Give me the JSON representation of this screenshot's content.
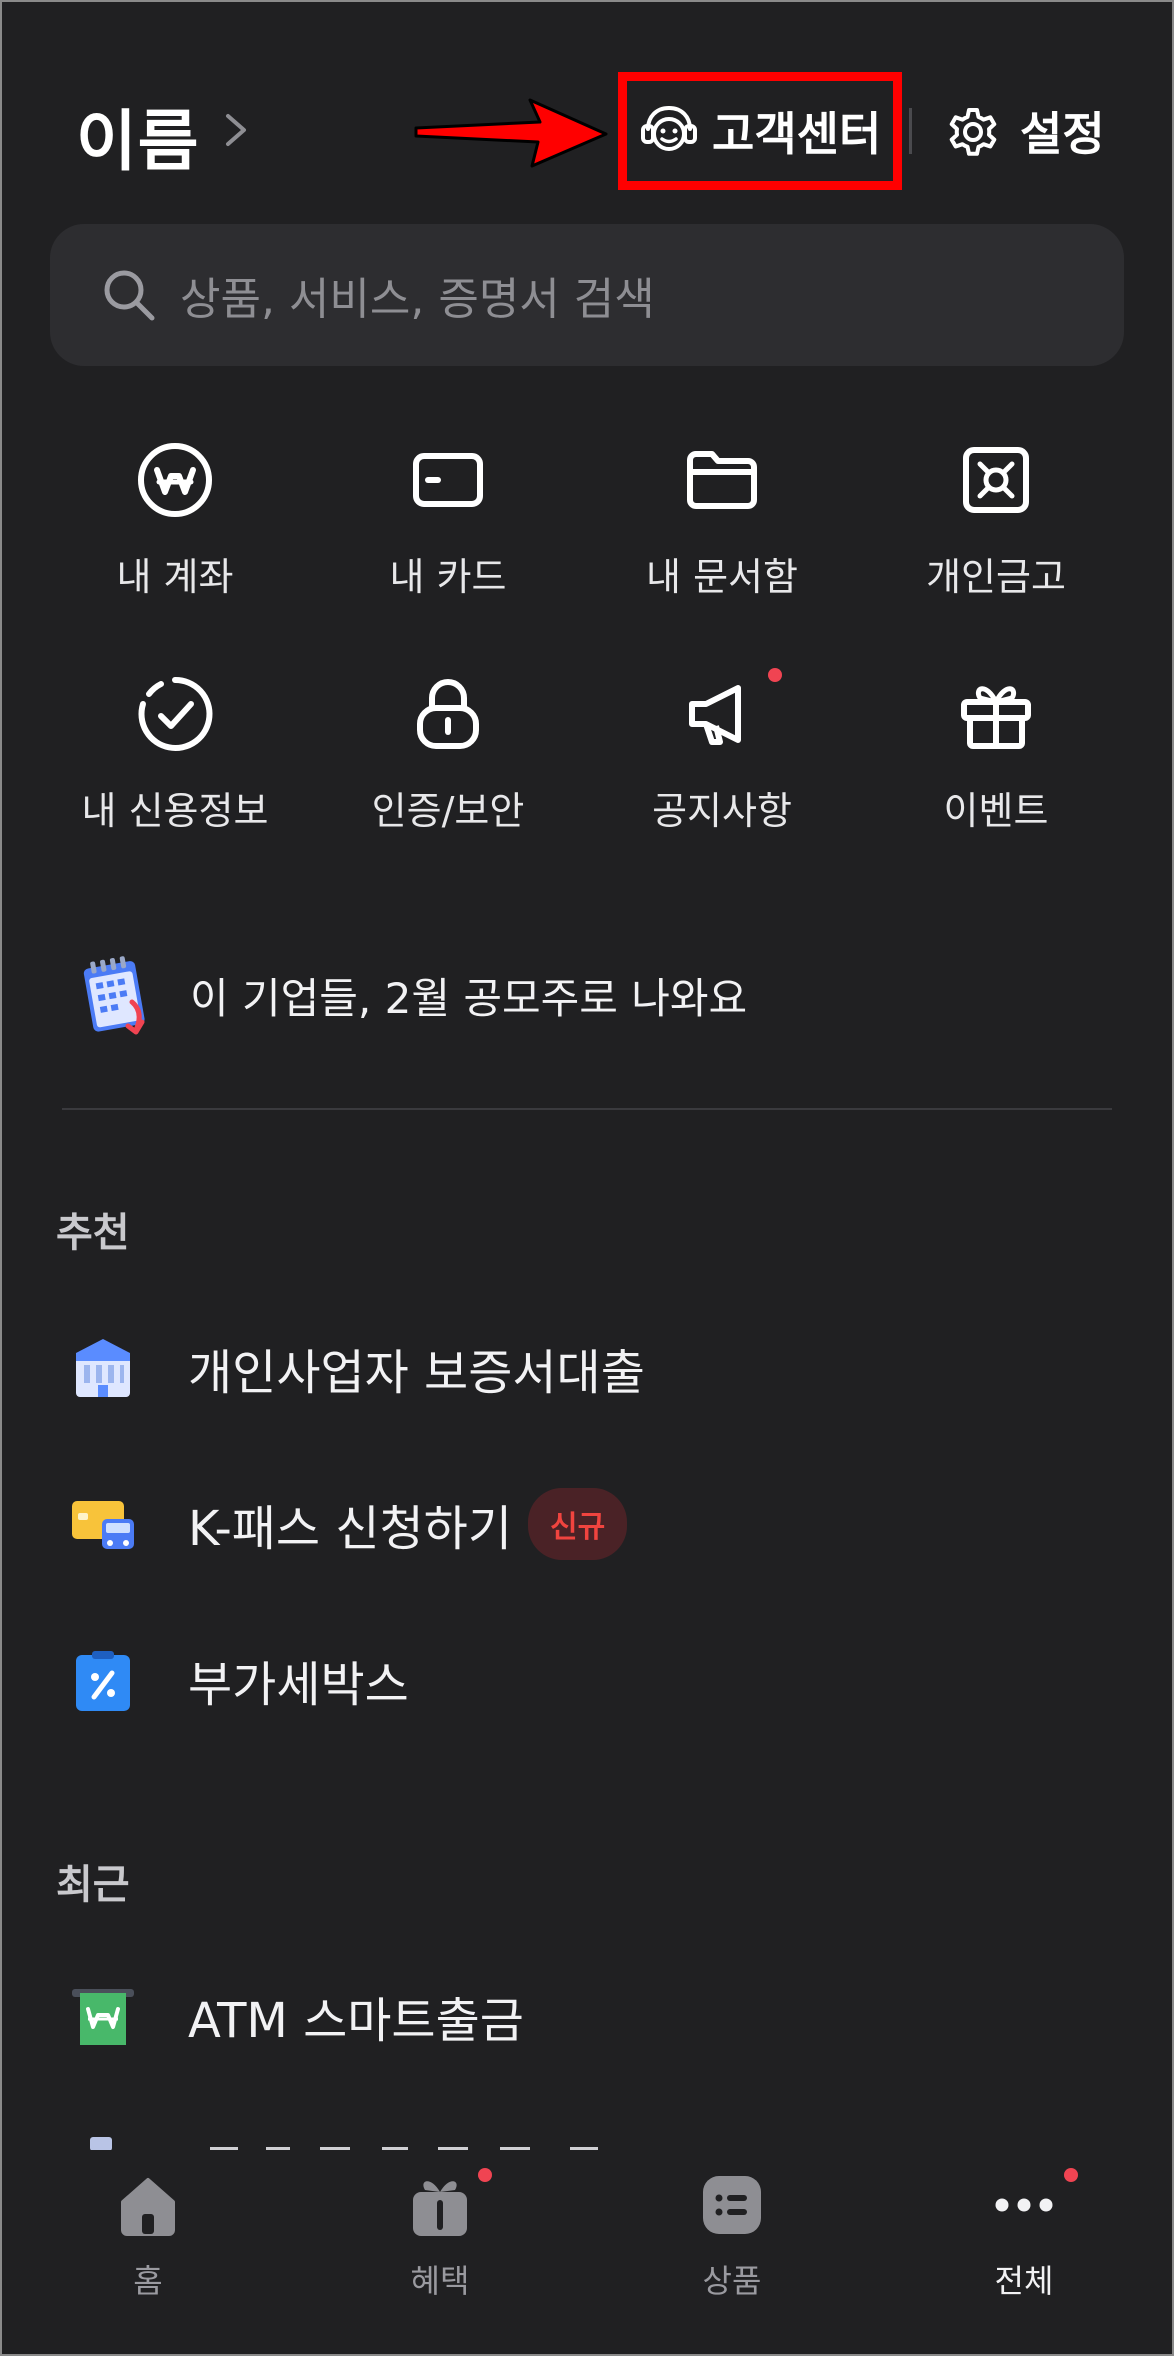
{
  "header": {
    "user_name": "이름",
    "customer_center_label": "고객센터",
    "settings_label": "설정",
    "highlight_color": "#ff0000"
  },
  "search": {
    "placeholder": "상품, 서비스, 증명서 검색"
  },
  "quick_menu": [
    {
      "label": "내 계좌",
      "icon": "won-coin-icon"
    },
    {
      "label": "내 카드",
      "icon": "card-icon"
    },
    {
      "label": "내 문서함",
      "icon": "folder-icon"
    },
    {
      "label": "개인금고",
      "icon": "safe-icon"
    },
    {
      "label": "내 신용정보",
      "icon": "credit-check-icon"
    },
    {
      "label": "인증/보안",
      "icon": "lock-icon"
    },
    {
      "label": "공지사항",
      "icon": "megaphone-icon",
      "has_new_dot": true
    },
    {
      "label": "이벤트",
      "icon": "gift-icon"
    }
  ],
  "banner": {
    "text": "이 기업들, 2월 공모주로 나와요",
    "icon": "calendar-icon"
  },
  "recommended": {
    "title": "추천",
    "items": [
      {
        "label": "개인사업자 보증서대출",
        "icon": "bank-building-icon"
      },
      {
        "label": "K-패스 신청하기",
        "icon": "card-bus-icon",
        "badge": "신규"
      },
      {
        "label": "부가세박스",
        "icon": "percent-clipboard-icon"
      }
    ]
  },
  "recent": {
    "title": "최근",
    "items": [
      {
        "label": "ATM 스마트출금",
        "icon": "atm-cash-icon"
      }
    ]
  },
  "bottom_nav": [
    {
      "label": "홈",
      "icon": "home-icon"
    },
    {
      "label": "혜택",
      "icon": "gift-icon",
      "has_new_dot": true
    },
    {
      "label": "상품",
      "icon": "list-icon"
    },
    {
      "label": "전체",
      "icon": "more-dots-icon",
      "has_new_dot": true,
      "active": true
    }
  ],
  "colors": {
    "background": "#202022",
    "accent_red": "#f04452",
    "badge_text": "#f0443f"
  }
}
